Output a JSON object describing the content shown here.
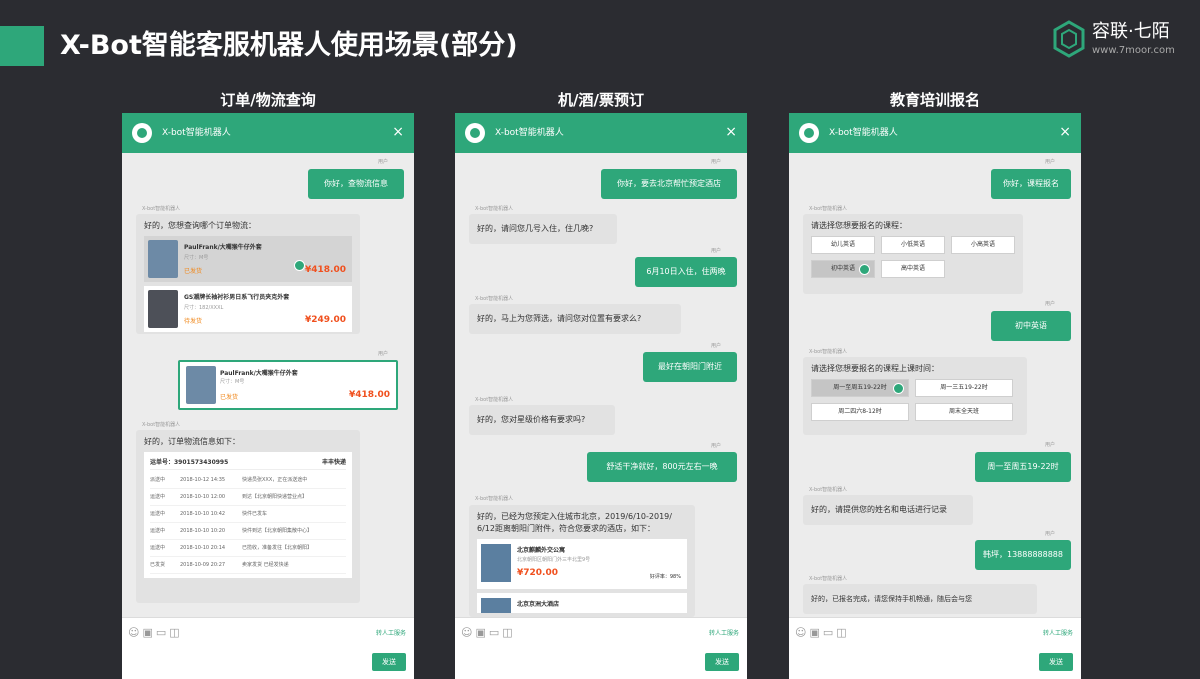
{
  "slide": {
    "title": "X-Bot智能客服机器人使用场景(部分)",
    "brand_name": "容联·七陌",
    "brand_url": "www.7moor.com",
    "accent_color": "#2ea77a",
    "background_color": "#2b2c31"
  },
  "common": {
    "bot_name": "X-bot智能机器人",
    "me_label": "用户",
    "bot_label": "X-bot智能机器人",
    "transfer_label": "转人工服务",
    "send_label": "发送",
    "close_icon": "×",
    "tool_icons": "☺▣▭◫"
  },
  "columns": [
    {
      "title": "订单/物流查询",
      "messages": {
        "m1": "你好，查物流信息",
        "b1": "好的，您想查询哪个订单物流：",
        "order1_name": "PaulFrank/大嘴猴牛仔外套",
        "order1_size": "尺寸：M号",
        "order1_status": "已发货",
        "order1_price": "¥418.00",
        "order2_name": "GS潮牌长袖衬衫男日系飞行员夹克外套",
        "order2_size": "尺寸：182/XXXL",
        "order2_status": "待发货",
        "order2_price": "¥249.00",
        "sel_name": "PaulFrank/大嘴猴牛仔外套",
        "sel_size": "尺寸：M号",
        "sel_status": "已发货",
        "sel_price": "¥418.00",
        "b2": "好的，订单物流信息如下：",
        "track_no": "运单号：3901573430995",
        "track_carrier": "丰丰快递",
        "track_rows": [
          {
            "st": "派送中",
            "tm": "2018-10-12 14:35",
            "info": "快递员张XXX，正在派送途中"
          },
          {
            "st": "运送中",
            "tm": "2018-10-10 12:00",
            "info": "到达【北京朝阳快递营业点】"
          },
          {
            "st": "运送中",
            "tm": "2018-10-10 10:42",
            "info": "快件已发车"
          },
          {
            "st": "运送中",
            "tm": "2018-10-10 10:20",
            "info": "快件到达【北京朝阳集散中心】"
          },
          {
            "st": "运送中",
            "tm": "2018-10-10 20:14",
            "info": "已揽收，准备发往【北京朝阳】"
          },
          {
            "st": "已发货",
            "tm": "2018-10-09 20:27",
            "info": "卖家发货 已经发快递"
          }
        ]
      }
    },
    {
      "title": "机/酒/票预订",
      "messages": {
        "m1": "你好，要去北京帮忙预定酒店",
        "b1": "好的，请问您几号入住，住几晚?",
        "m2": "6月10日入住，住两晚",
        "b2": "好的，马上为您筛选，请问您对位置有要求么?",
        "m3": "最好在朝阳门附近",
        "b3": "好的，您对星级价格有要求吗?",
        "m4": "舒适干净就好，800元左右一晚",
        "b4_line1": "好的，已经为您预定入住城市北京，2019/6/10-2019/",
        "b4_line2": "6/12距离朝阳门附件，符合您要求的酒店，如下：",
        "hotel1_name": "北京麒麟外交公寓",
        "hotel1_addr": "北京朝阳区朝阳门外三丰北里9号",
        "hotel1_price": "¥720.00",
        "hotel1_rate": "好评率：98%",
        "hotel2_name": "北京京洲大酒店"
      }
    },
    {
      "title": "教育培训报名",
      "messages": {
        "m1": "你好，课程报名",
        "b1": "请选择您想要报名的课程：",
        "courses": [
          "幼儿英语",
          "小低英语",
          "小高英语",
          "初中英语",
          "高中英语"
        ],
        "m2": "初中英语",
        "b2": "请选择您想要报名的课程上课时间：",
        "times": [
          "周一至周五19-22时",
          "周一三五19-22时",
          "周二四六8-12时",
          "周末全天班"
        ],
        "m3": "周一至周五19-22时",
        "b3": "好的，请提供您的姓名和电话进行记录",
        "m4": "韩坪，13888888888",
        "b4": "好的，已报名完成，请您保持手机畅通，随后会与您"
      }
    }
  ]
}
